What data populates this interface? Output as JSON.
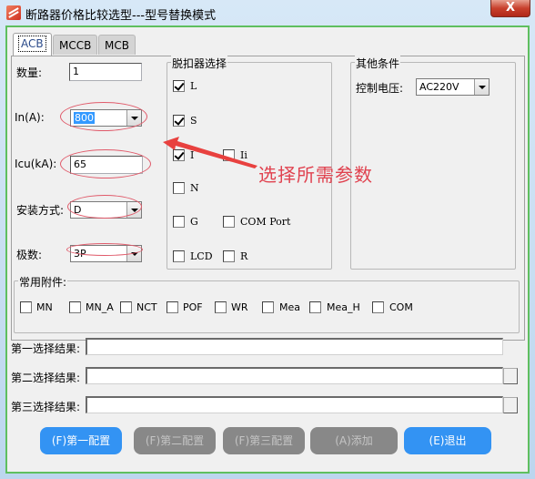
{
  "window": {
    "title": "断路器价格比较选型---型号替换模式",
    "close_label": "X"
  },
  "tabs": [
    {
      "label": "ACB",
      "active": true
    },
    {
      "label": "MCCB",
      "active": false
    },
    {
      "label": "MCB",
      "active": false
    }
  ],
  "form": {
    "quantity": {
      "label": "数量:",
      "value": "1"
    },
    "in_a": {
      "label": "In(A):",
      "value": "800"
    },
    "icu_ka": {
      "label": "Icu(kA):",
      "value": "65"
    },
    "mounting": {
      "label": "安装方式:",
      "value": "D"
    },
    "poles": {
      "label": "极数:",
      "value": "3P"
    }
  },
  "trip_unit": {
    "title": "脱扣器选择",
    "options": [
      {
        "label": "L",
        "checked": true
      },
      {
        "label": "S",
        "checked": true
      },
      {
        "label": "I",
        "checked": true
      },
      {
        "label": "Ii",
        "checked": false
      },
      {
        "label": "N",
        "checked": false
      },
      {
        "label": "G",
        "checked": false
      },
      {
        "label": "COM Port",
        "checked": false
      },
      {
        "label": "LCD",
        "checked": false
      },
      {
        "label": "R",
        "checked": false
      }
    ]
  },
  "other_conditions": {
    "title": "其他条件",
    "control_voltage": {
      "label": "控制电压:",
      "value": "AC220V"
    }
  },
  "accessories": {
    "title": "常用附件:",
    "options": [
      {
        "label": "MN",
        "checked": false
      },
      {
        "label": "MN_A",
        "checked": false
      },
      {
        "label": "NCT",
        "checked": false
      },
      {
        "label": "POF",
        "checked": false
      },
      {
        "label": "WR",
        "checked": false
      },
      {
        "label": "Mea",
        "checked": false
      },
      {
        "label": "Mea_H",
        "checked": false
      },
      {
        "label": "COM",
        "checked": false
      }
    ]
  },
  "annotation": {
    "text": "选择所需参数",
    "color": "#e0424f"
  },
  "results": [
    {
      "label": "第一选择结果:",
      "value": ""
    },
    {
      "label": "第二选择结果:",
      "value": ""
    },
    {
      "label": "第三选择结果:",
      "value": ""
    }
  ],
  "buttons": [
    {
      "label": "(F)第一配置",
      "enabled": true
    },
    {
      "label": "(F)第二配置",
      "enabled": false
    },
    {
      "label": "(F)第三配置",
      "enabled": false
    },
    {
      "label": "(A)添加",
      "enabled": false
    },
    {
      "label": "(E)退出",
      "enabled": true
    }
  ],
  "colors": {
    "primary_button": "#3393f3",
    "disabled_button": "#888888",
    "frame_border": "#5fbf5f"
  }
}
